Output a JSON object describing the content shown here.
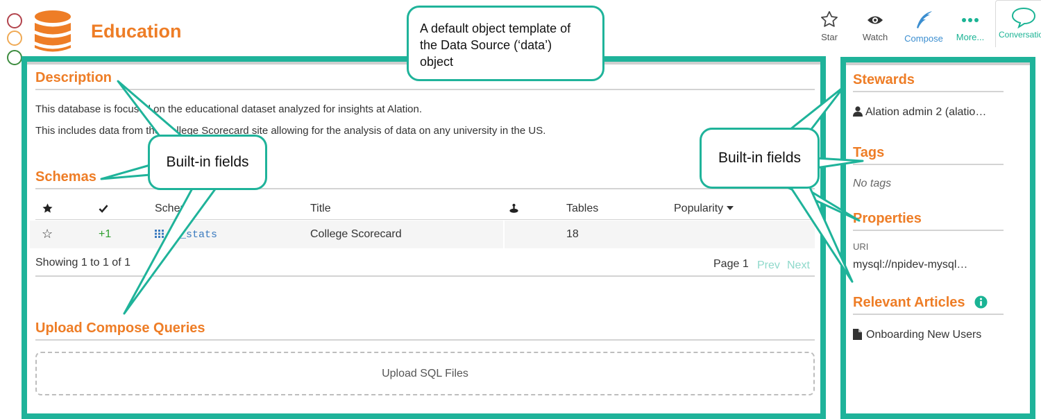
{
  "header": {
    "title": "Education",
    "logo_icon": "database-icon",
    "brand_color": "#ee7d26",
    "actions": {
      "star": "Star",
      "watch": "Watch",
      "compose": "Compose",
      "more": "More...",
      "conversations": "Conversations"
    }
  },
  "annotations": {
    "frame_color": "#1fb39a",
    "top_callout": [
      "A default  object template of",
      "the Data Source (‘data’)",
      "object"
    ],
    "left_callout": "Built-in fields",
    "right_callout": "Built-in fields"
  },
  "main": {
    "description": {
      "title": "Description",
      "lines": [
        "This database is focused on the educational dataset analyzed for insights at Alation.",
        "This includes data from the College Scorecard site allowing for the analysis of data on any university in the US."
      ]
    },
    "schemas": {
      "title": "Schemas",
      "columns": [
        "",
        "",
        "Schema",
        "Title",
        "",
        "Tables",
        "Popularity"
      ],
      "rows": [
        {
          "star": "☆",
          "votes": "+1",
          "schema": "ed_stats",
          "title": "College Scorecard",
          "tables": "18"
        }
      ],
      "showing": "Showing 1 to 1 of 1",
      "page": "Page 1",
      "prev": "Prev",
      "next": "Next"
    },
    "upload": {
      "title": "Upload Compose Queries",
      "button": "Upload SQL Files"
    }
  },
  "sidebar": {
    "stewards": {
      "title": "Stewards",
      "items": [
        "Alation admin 2 (alatio…"
      ]
    },
    "tags": {
      "title": "Tags",
      "empty": "No tags"
    },
    "properties": {
      "title": "Properties",
      "uri_label": "URI",
      "uri_value": "mysql://npidev-mysql…"
    },
    "articles": {
      "title": "Relevant Articles",
      "items": [
        "Onboarding New Users"
      ]
    }
  }
}
